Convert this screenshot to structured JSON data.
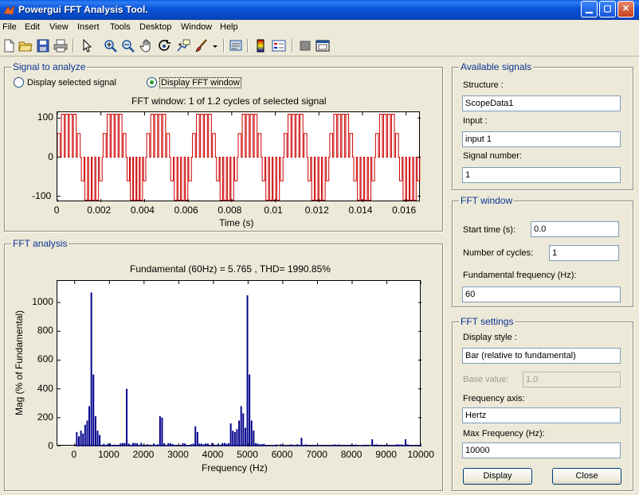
{
  "window": {
    "title": "Powergui FFT Analysis Tool.",
    "controls": [
      "minimize",
      "maximize",
      "close"
    ]
  },
  "menu": [
    "File",
    "Edit",
    "View",
    "Insert",
    "Tools",
    "Desktop",
    "Window",
    "Help"
  ],
  "toolbar_icons": [
    "new-file-icon",
    "open-folder-icon",
    "save-icon",
    "print-icon",
    "pointer-icon",
    "zoom-in-icon",
    "zoom-out-icon",
    "pan-hand-icon",
    "rotate-icon",
    "data-cursor-icon",
    "brush-icon",
    "print-preview-icon",
    "colorbar-icon",
    "legend-icon",
    "hide-plot-tools-icon",
    "show-plot-tools-icon"
  ],
  "signal_panel": {
    "title": "Signal to analyze",
    "radio_selected": "Display selected signal",
    "radio_fft": "Display FFT window",
    "fft_selected": true
  },
  "available_signals": {
    "title": "Available signals",
    "structure_label": "Structure :",
    "structure_value": "ScopeData1",
    "input_label": "Input :",
    "input_value": "input 1",
    "signal_number_label": "Signal number:",
    "signal_number_value": "1"
  },
  "fft_window": {
    "title": "FFT window",
    "start_time_label": "Start time (s):",
    "start_time_value": "0.0",
    "cycles_label": "Number of cycles:",
    "cycles_value": "1",
    "fund_freq_label": "Fundamental frequency (Hz):",
    "fund_freq_value": "60"
  },
  "fft_settings": {
    "title": "FFT settings",
    "display_style_label": "Display style :",
    "display_style_value": "Bar (relative to fundamental)",
    "base_value_label": "Base value:",
    "base_value_value": "1.0",
    "freq_axis_label": "Frequency axis:",
    "freq_axis_value": "Hertz",
    "max_freq_label": "Max Frequency (Hz):",
    "max_freq_value": "10000",
    "display_button": "Display",
    "close_button": "Close"
  },
  "fft_panel": {
    "title": "FFT analysis"
  },
  "colors": {
    "signal_line": "#cc0000",
    "bar": "#00008b",
    "panel_title": "#0a3491"
  },
  "chart_data": [
    {
      "type": "line",
      "title": "FFT window: 1 of 1.2 cycles of selected signal",
      "xlabel": "Time (s)",
      "ylabel": "",
      "xlim": [
        0,
        0.01667
      ],
      "ylim": [
        -115,
        115
      ],
      "xticks": [
        "0",
        "0.002",
        "0.004",
        "0.006",
        "0.008",
        "0.01",
        "0.012",
        "0.014",
        "0.016"
      ],
      "xtick_values": [
        0,
        0.002,
        0.004,
        0.006,
        0.008,
        0.01,
        0.012,
        0.014,
        0.016
      ],
      "yticks": [
        "-100",
        "0",
        "100"
      ],
      "ytick_values": [
        -100,
        0,
        100
      ],
      "high_windows": [
        [
          0.0,
          0.0011
        ],
        [
          0.0021,
          0.0032
        ],
        [
          0.0041,
          0.0052
        ],
        [
          0.0062,
          0.0073
        ],
        [
          0.0083,
          0.0094
        ],
        [
          0.0104,
          0.0115
        ],
        [
          0.0125,
          0.0136
        ],
        [
          0.0146,
          0.0157
        ]
      ],
      "low_windows": [
        [
          0.0011,
          0.0021
        ],
        [
          0.0032,
          0.0041
        ],
        [
          0.0052,
          0.0062
        ],
        [
          0.0073,
          0.0083
        ],
        [
          0.0094,
          0.0104
        ],
        [
          0.0115,
          0.0125
        ],
        [
          0.0136,
          0.0146
        ],
        [
          0.0157,
          0.01667
        ]
      ],
      "amplitude": 110
    },
    {
      "type": "bar",
      "title": "Fundamental (60Hz) = 5.765 , THD= 1990.85%",
      "xlabel": "Frequency (Hz)",
      "ylabel": "Mag (% of Fundamental)",
      "xlim": [
        -500,
        10000
      ],
      "ylim": [
        0,
        1150
      ],
      "xticks": [
        "0",
        "1000",
        "2000",
        "3000",
        "4000",
        "5000",
        "6000",
        "7000",
        "8000",
        "9000",
        "10000"
      ],
      "xtick_values": [
        0,
        1000,
        2000,
        3000,
        4000,
        5000,
        6000,
        7000,
        8000,
        9000,
        10000
      ],
      "yticks": [
        "0",
        "200",
        "400",
        "600",
        "800",
        "1000"
      ],
      "ytick_values": [
        0,
        200,
        400,
        600,
        800,
        1000
      ],
      "bin_width_hz": 60,
      "peaks": [
        {
          "x": 60,
          "y": 100
        },
        {
          "x": 120,
          "y": 70
        },
        {
          "x": 180,
          "y": 110
        },
        {
          "x": 240,
          "y": 90
        },
        {
          "x": 300,
          "y": 150
        },
        {
          "x": 360,
          "y": 180
        },
        {
          "x": 420,
          "y": 280
        },
        {
          "x": 480,
          "y": 1070
        },
        {
          "x": 540,
          "y": 500
        },
        {
          "x": 600,
          "y": 210
        },
        {
          "x": 660,
          "y": 110
        },
        {
          "x": 720,
          "y": 80
        },
        {
          "x": 1500,
          "y": 400
        },
        {
          "x": 2460,
          "y": 210
        },
        {
          "x": 2520,
          "y": 200
        },
        {
          "x": 3480,
          "y": 140
        },
        {
          "x": 3540,
          "y": 100
        },
        {
          "x": 4500,
          "y": 160
        },
        {
          "x": 4560,
          "y": 110
        },
        {
          "x": 4620,
          "y": 100
        },
        {
          "x": 4680,
          "y": 120
        },
        {
          "x": 4740,
          "y": 180
        },
        {
          "x": 4800,
          "y": 280
        },
        {
          "x": 4860,
          "y": 230
        },
        {
          "x": 4920,
          "y": 130
        },
        {
          "x": 4980,
          "y": 1050
        },
        {
          "x": 5040,
          "y": 500
        },
        {
          "x": 5100,
          "y": 180
        },
        {
          "x": 5160,
          "y": 110
        },
        {
          "x": 6540,
          "y": 60
        },
        {
          "x": 8580,
          "y": 50
        },
        {
          "x": 9540,
          "y": 50
        }
      ],
      "floor": 25
    }
  ]
}
